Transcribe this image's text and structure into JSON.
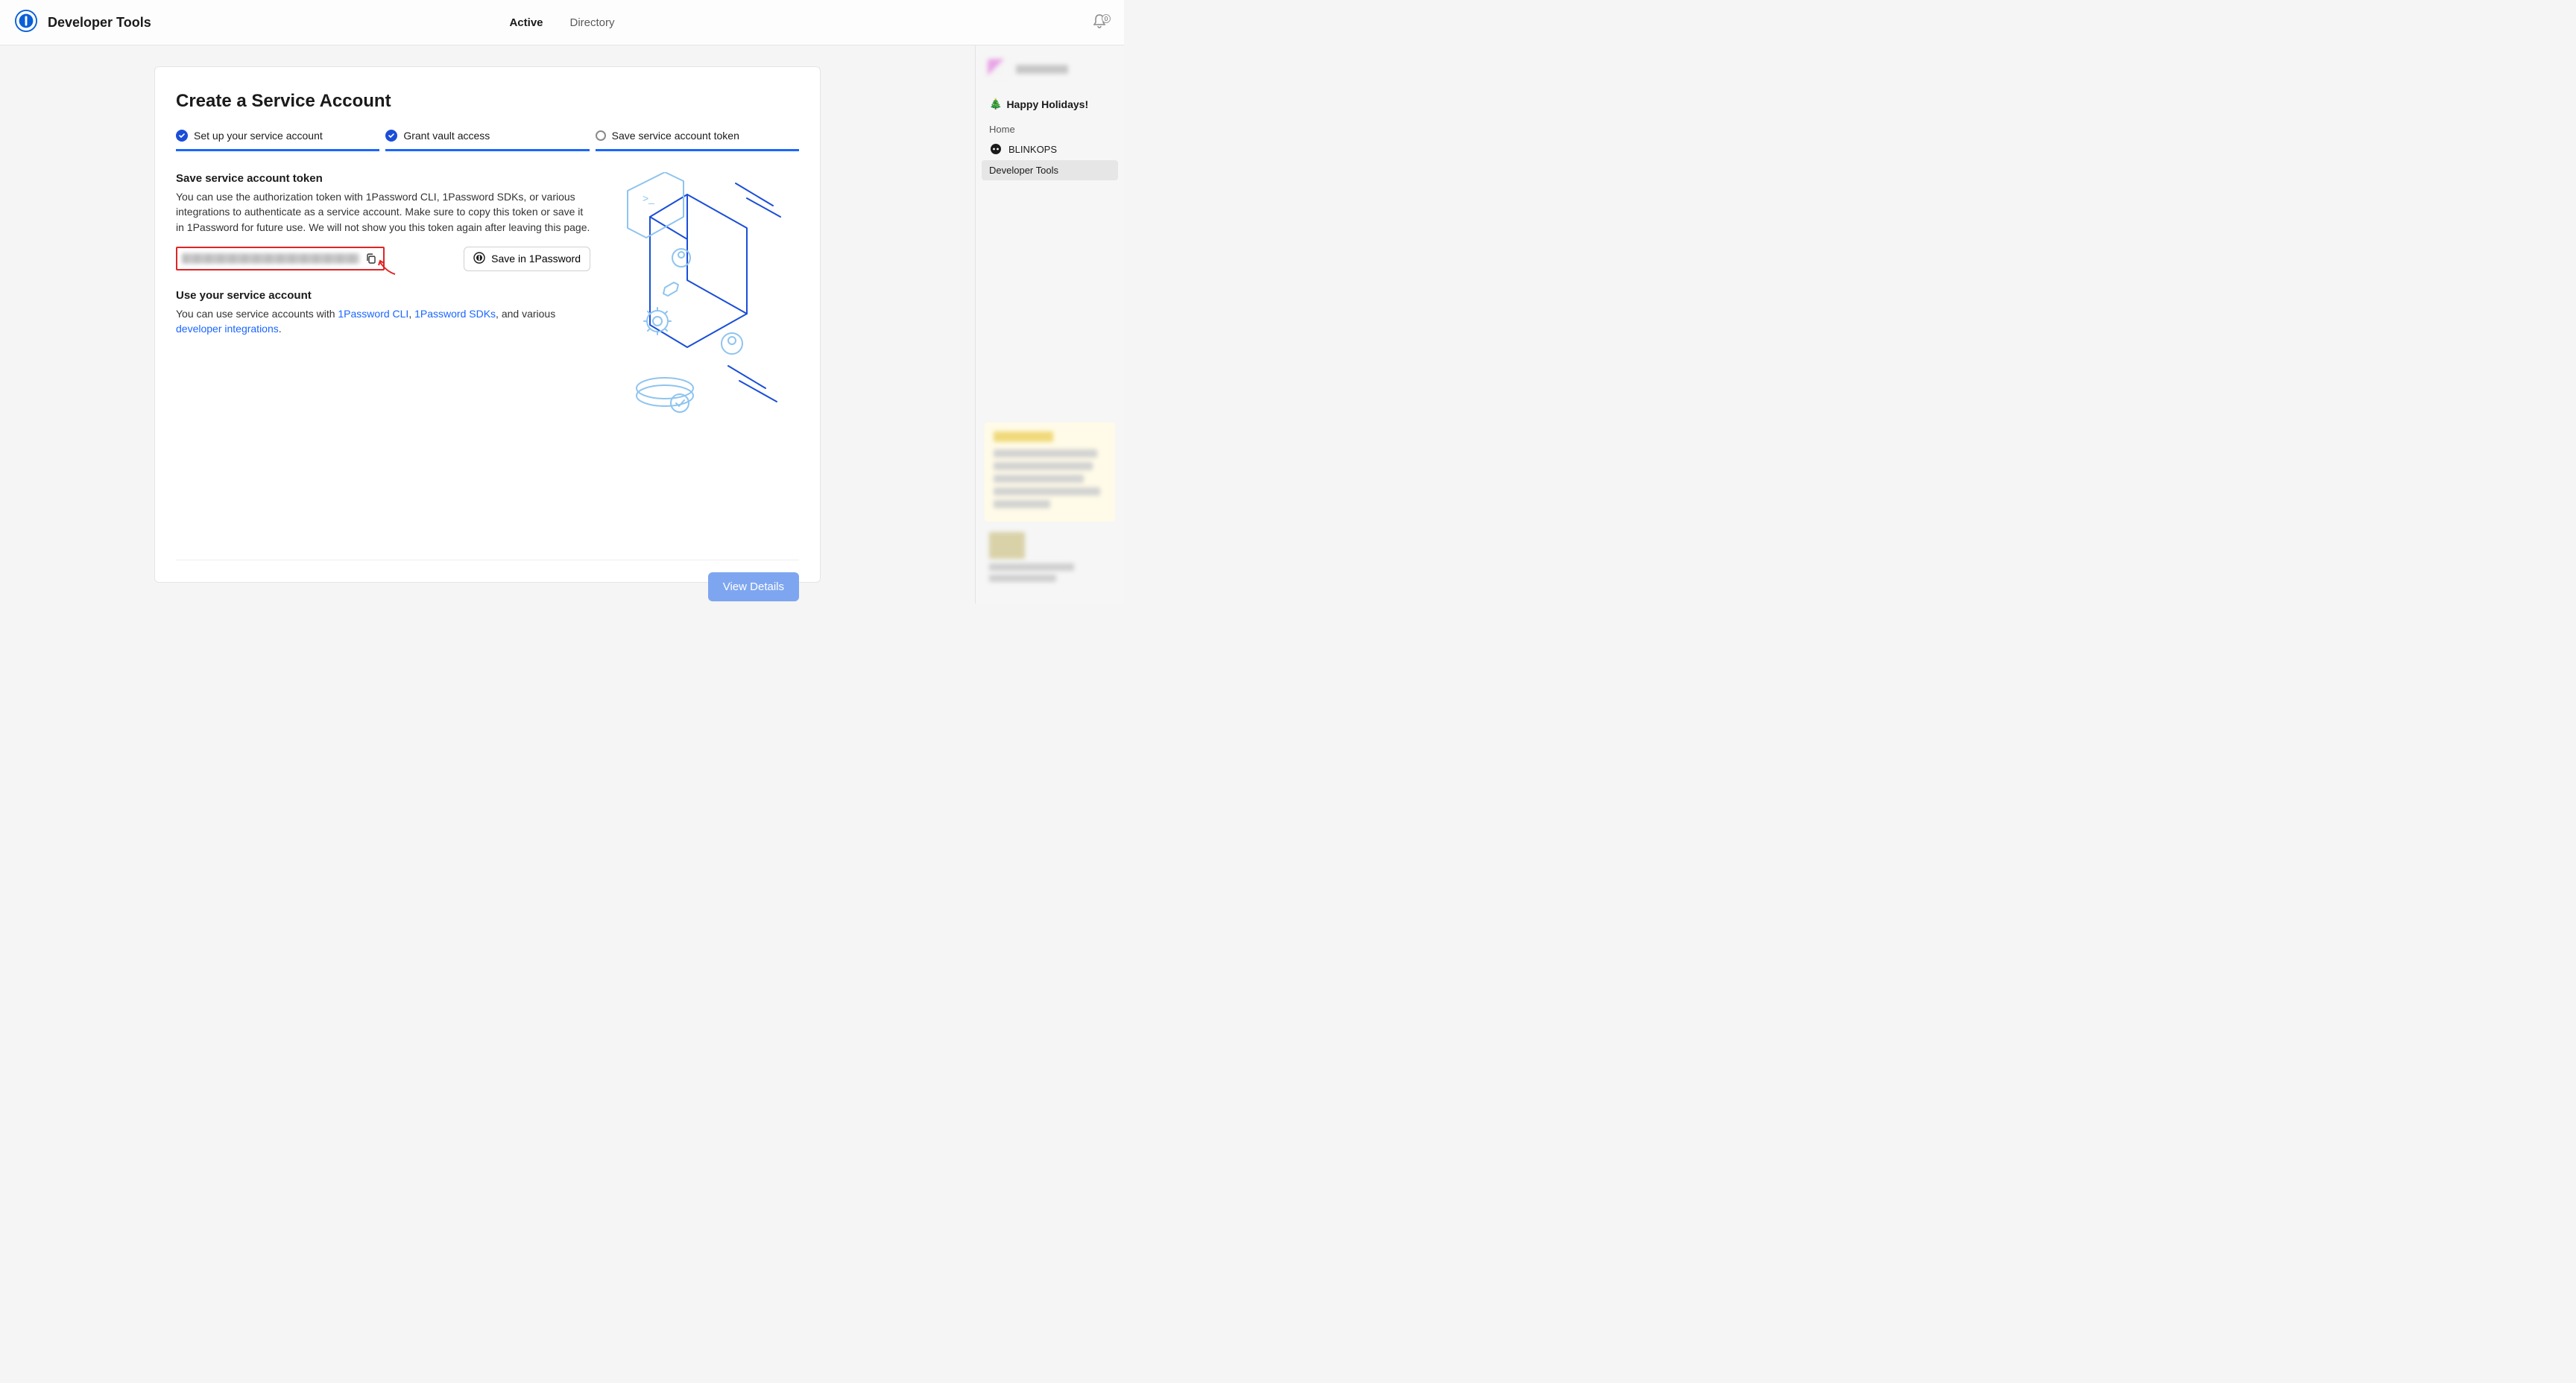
{
  "header": {
    "title": "Developer Tools",
    "nav": {
      "active": "Active",
      "directory": "Directory"
    },
    "notification_count": "0"
  },
  "card": {
    "heading": "Create a Service Account",
    "steps": [
      {
        "label": "Set up your service account",
        "done": true
      },
      {
        "label": "Grant vault access",
        "done": true
      },
      {
        "label": "Save service account token",
        "done": false
      }
    ],
    "save_token": {
      "title": "Save service account token",
      "description": "You can use the authorization token with 1Password CLI, 1Password SDKs, or various integrations to authenticate as a service account. Make sure to copy this token or save it in 1Password for future use. We will not show you this token again after leaving this page.",
      "save_button_label": "Save in 1Password"
    },
    "use_account": {
      "title": "Use your service account",
      "prefix": "You can use service accounts with ",
      "link_cli": "1Password CLI",
      "sep1": ", ",
      "link_sdks": "1Password SDKs",
      "sep2": ", and various ",
      "link_dev": "developer integrations",
      "suffix": "."
    },
    "footer": {
      "view_details": "View Details"
    }
  },
  "sidebar": {
    "greeting": "Happy Holidays!",
    "home_label": "Home",
    "items": [
      {
        "label": "BLINKOPS"
      },
      {
        "label": "Developer Tools"
      }
    ]
  }
}
